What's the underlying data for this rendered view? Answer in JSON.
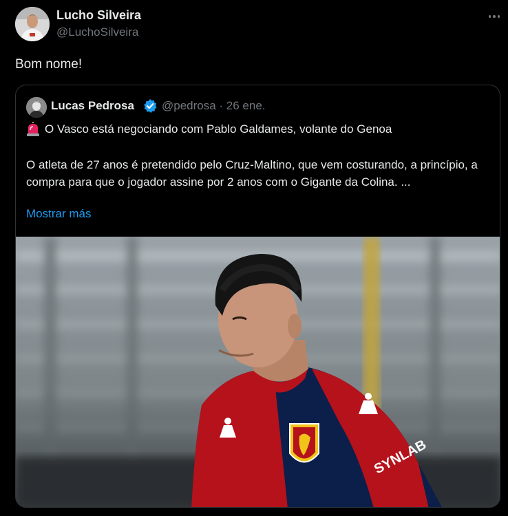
{
  "tweet": {
    "author_name": "Lucho Silveira",
    "author_handle": "@LuchoSilveira",
    "text": "Bom nome!",
    "more_icon": "more-horizontal-icon"
  },
  "quoted": {
    "author_name": "Lucas Pedrosa",
    "handle_date": "@pedrosa · 26 ene.",
    "verified_icon": "verified-badge-icon",
    "line1_icon": "siren-icon",
    "line1": "O Vasco está negociando com Pablo Galdames, volante do Genoa",
    "paragraph": "O atleta de 27 anos é pretendido pelo Cruz-Maltino, que vem costurando, a princípio, a compra para que o jogador assine por 2 anos com o Gigante da Colina. ...",
    "show_more": "Mostrar más",
    "media": {
      "jersey_brand": "Kappa",
      "jersey_sponsor": "SYNLAB",
      "jersey_colors": [
        "#b5121b",
        "#0b1f4a"
      ]
    }
  },
  "colors": {
    "background": "#000000",
    "text": "#e7e9ea",
    "muted": "#71767b",
    "link": "#1d9bf0",
    "border": "#2f3336"
  }
}
